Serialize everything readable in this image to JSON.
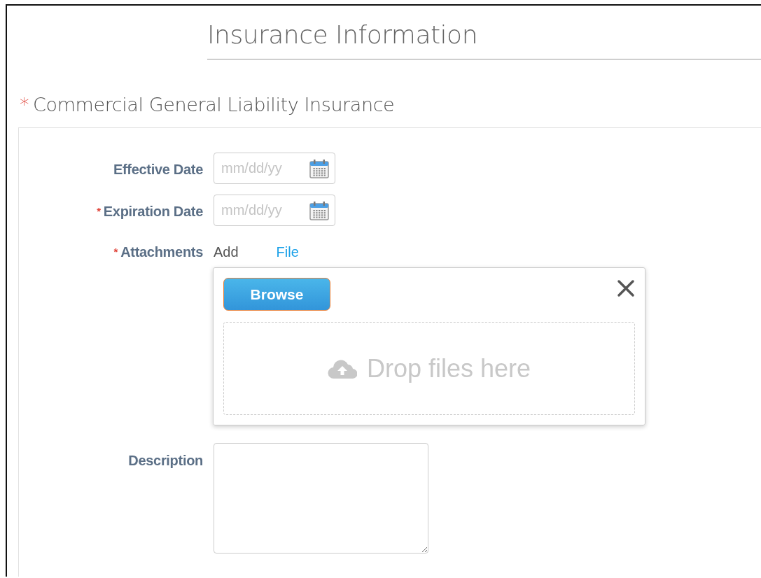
{
  "heading": "Insurance Information",
  "section": {
    "title": "Commercial General Liability Insurance",
    "required_mark": "*"
  },
  "fields": [
    {
      "kind": "date",
      "label": "Effective Date",
      "placeholder": "mm/dd/yy"
    },
    {
      "kind": "date",
      "label": "Expiration Date",
      "required_mark": "*",
      "placeholder": "mm/dd/yy"
    },
    {
      "kind": "attachment",
      "label": "Attachments",
      "required_mark": "*",
      "add_text": "Add",
      "link": "File",
      "popup": {
        "button": "Browse",
        "drop_text": "Drop files here"
      }
    },
    {
      "kind": "textarea",
      "label": "Description"
    }
  ]
}
